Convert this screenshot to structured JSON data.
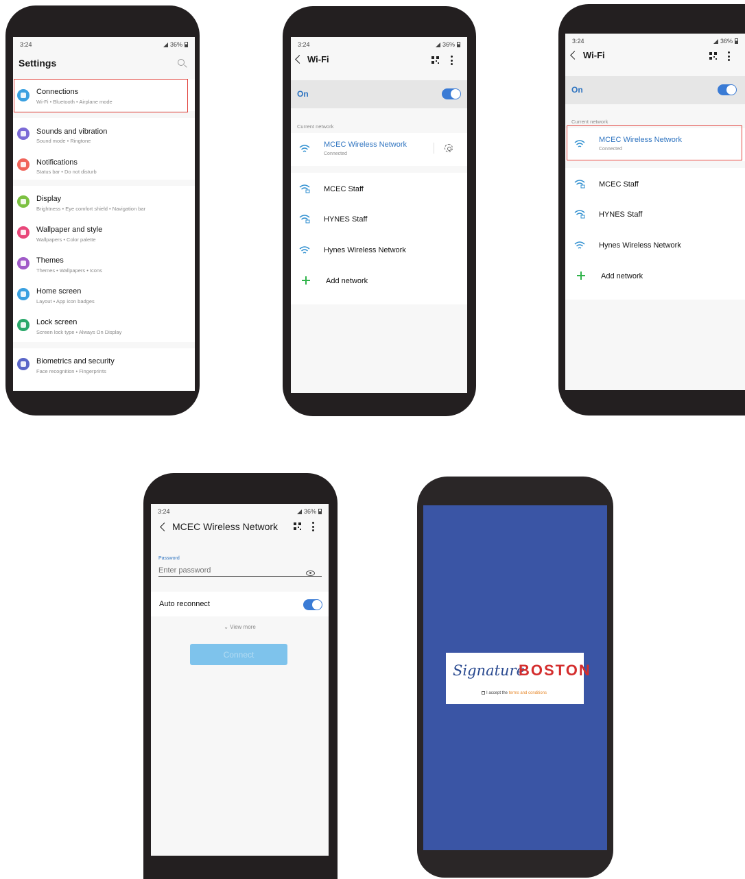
{
  "status": {
    "time": "3:24",
    "battery": "36%"
  },
  "settings": {
    "title": "Settings",
    "items": [
      {
        "title": "Connections",
        "sub": "Wi-Fi  •  Bluetooth  •  Airplane mode",
        "color": "#3aa0e0"
      },
      {
        "title": "Sounds and vibration",
        "sub": "Sound mode  •  Ringtone",
        "color": "#7b6ad6"
      },
      {
        "title": "Notifications",
        "sub": "Status bar  •  Do not disturb",
        "color": "#f0645a"
      },
      {
        "title": "Display",
        "sub": "Brightness  •  Eye comfort shield  •  Navigation bar",
        "color": "#7cc142"
      },
      {
        "title": "Wallpaper and style",
        "sub": "Wallpapers  •  Color palette",
        "color": "#e8477a"
      },
      {
        "title": "Themes",
        "sub": "Themes  •  Wallpapers  •  Icons",
        "color": "#a05bc8"
      },
      {
        "title": "Home screen",
        "sub": "Layout  •  App icon badges",
        "color": "#3aa0e0"
      },
      {
        "title": "Lock screen",
        "sub": "Screen lock type  •  Always On Display",
        "color": "#2aa86a"
      },
      {
        "title": "Biometrics and security",
        "sub": "Face recognition  •  Fingerprints",
        "color": "#5a66c8"
      }
    ]
  },
  "wifi": {
    "title": "Wi-Fi",
    "on_label": "On",
    "current_label": "Current network",
    "current_network": "MCEC Wireless Network",
    "current_status": "Connected",
    "networks": [
      "MCEC Staff",
      "HYNES Staff",
      "Hynes Wireless Network"
    ],
    "add_network": "Add network"
  },
  "connect": {
    "title": "MCEC Wireless Network",
    "password_label": "Password",
    "password_placeholder": "Enter password",
    "auto_reconnect": "Auto reconnect",
    "view_more": "View more",
    "connect_button": "Connect"
  },
  "portal": {
    "brand_script": "Signature",
    "brand_name": "BOSTON",
    "accept_prefix": "I accept the ",
    "terms_link": "terms and conditions",
    "background": "#3a55a5"
  },
  "colors": {
    "accent": "#2f74c0",
    "highlight": "#e0403a",
    "toggle": "#3a7bd5"
  }
}
